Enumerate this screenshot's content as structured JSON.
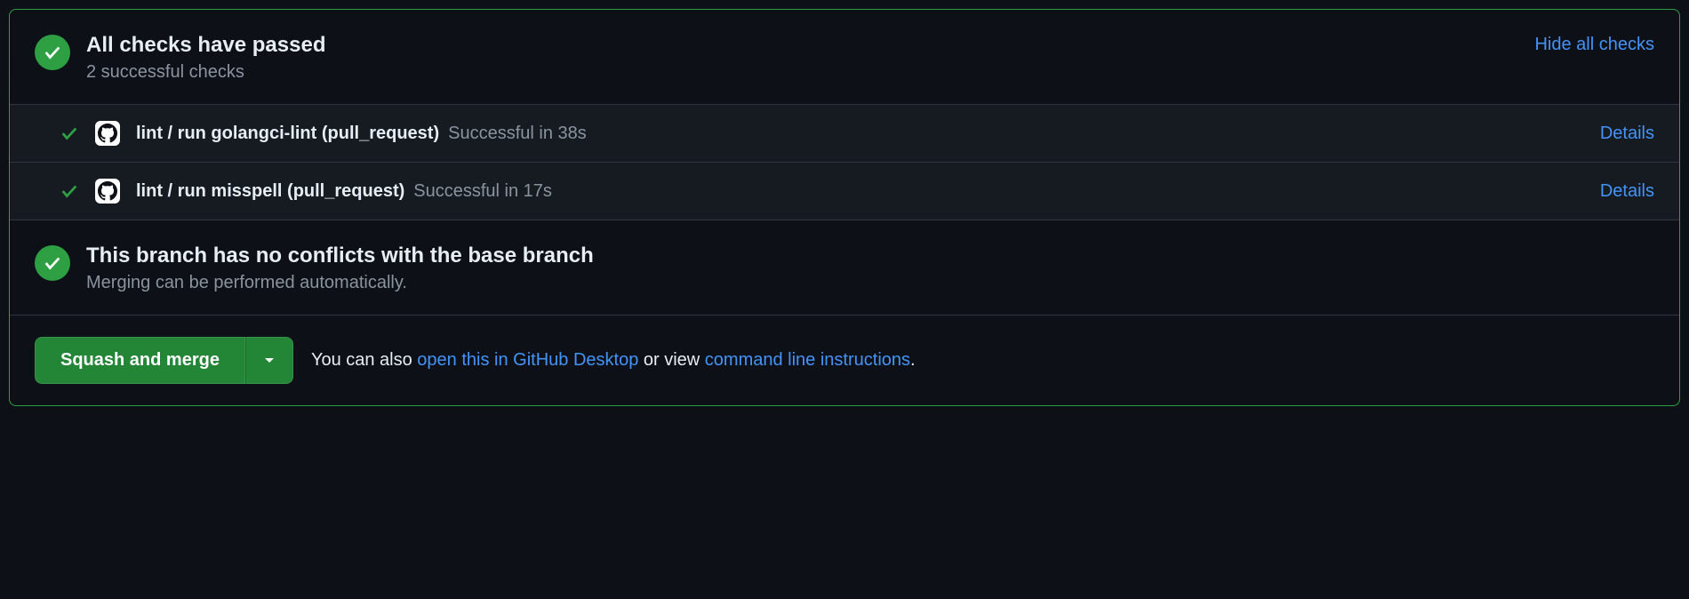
{
  "checks_header": {
    "title": "All checks have passed",
    "subtitle": "2 successful checks",
    "hide_link": "Hide all checks"
  },
  "checks": [
    {
      "name": "lint / run golangci-lint (pull_request)",
      "status": "Successful in 38s",
      "details_label": "Details"
    },
    {
      "name": "lint / run misspell (pull_request)",
      "status": "Successful in 17s",
      "details_label": "Details"
    }
  ],
  "conflicts": {
    "title": "This branch has no conflicts with the base branch",
    "subtitle": "Merging can be performed automatically."
  },
  "footer": {
    "merge_button": "Squash and merge",
    "text_before": "You can also ",
    "link_desktop": "open this in GitHub Desktop",
    "text_middle": " or view ",
    "link_cli": "command line instructions",
    "text_after": "."
  }
}
